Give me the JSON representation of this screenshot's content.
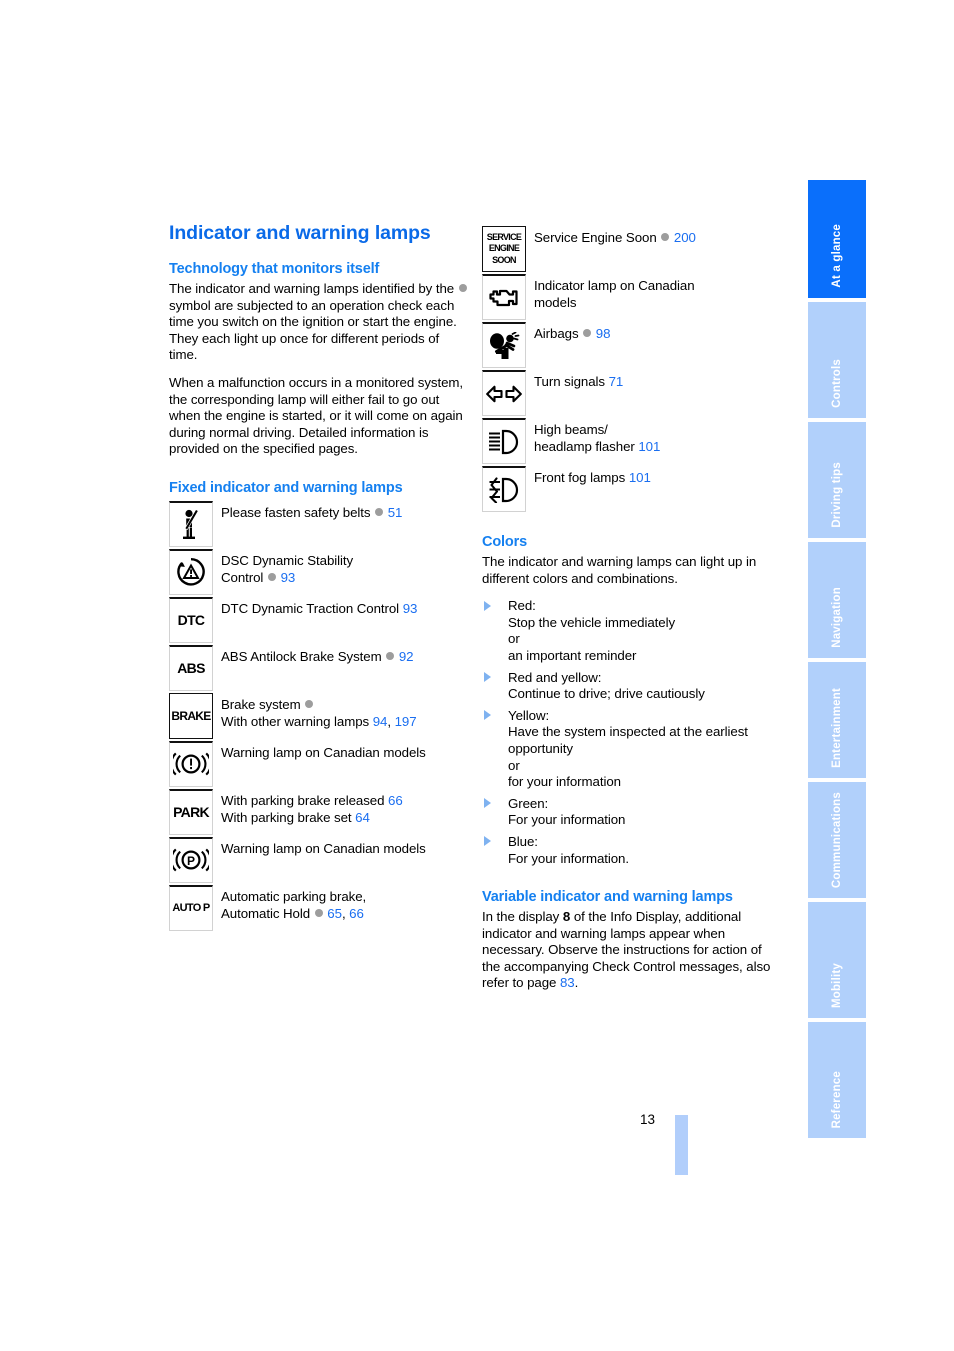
{
  "page": {
    "number": "13"
  },
  "left_column": {
    "title": "Indicator and warning lamps",
    "section1": {
      "heading": "Technology that monitors itself",
      "para1_a": "The indicator and warning lamps identified by the",
      "para1_b": "symbol are subjected to an operation check each time you switch on the ignition or start the engine. They each light up once for different periods of time.",
      "para2": "When a malfunction occurs in a monitored system, the corresponding lamp will either fail to go out when the engine is started, or it will come on again during normal driving. Detailed information is provided on the specified pages."
    },
    "section2": {
      "heading": "Fixed indicator and warning lamps",
      "lamps": [
        {
          "icon": "seatbelt-icon",
          "icon_kind": "glyph",
          "line1": "Please fasten safety belts",
          "line1_has_circle": true,
          "line1_pages": [
            "51"
          ],
          "line2": "",
          "line2_pages": []
        },
        {
          "icon": "dsc-triangle-icon",
          "icon_kind": "glyph",
          "line1": "DSC Dynamic Stability",
          "line1_has_circle": false,
          "line1_pages": [],
          "line2": "Control",
          "line2_has_circle": true,
          "line2_pages": [
            "93"
          ]
        },
        {
          "icon": "dtc-icon",
          "icon_kind": "text",
          "icon_text": "DTC",
          "line1": "DTC Dynamic Traction Control",
          "line1_has_circle": false,
          "line1_pages": [
            "93"
          ],
          "line2": "",
          "line2_pages": []
        },
        {
          "icon": "abs-icon",
          "icon_kind": "text",
          "icon_text": "ABS",
          "line1": "ABS Antilock Brake System",
          "line1_has_circle": true,
          "line1_pages": [
            "92"
          ],
          "line2": "",
          "line2_pages": []
        },
        {
          "icon": "brake-icon",
          "icon_kind": "text-boxed",
          "icon_text": "BRAKE",
          "line1": "Brake system",
          "line1_has_circle": true,
          "line1_pages": [],
          "line2": "With other warning lamps",
          "line2_has_circle": false,
          "line2_pages": [
            "94",
            "197"
          ]
        },
        {
          "icon": "brake-warning-canadian-icon",
          "icon_kind": "glyph",
          "line1": "Warning lamp on Canadian models",
          "line1_has_circle": false,
          "line1_pages": [],
          "line2": "",
          "line2_pages": []
        },
        {
          "icon": "park-icon",
          "icon_kind": "text",
          "icon_text": "PARK",
          "line1": "With parking brake released",
          "line1_has_circle": false,
          "line1_pages": [
            "66"
          ],
          "line2": "With parking brake set",
          "line2_has_circle": false,
          "line2_pages": [
            "64"
          ]
        },
        {
          "icon": "parking-brake-canadian-icon",
          "icon_kind": "glyph",
          "line1": "Warning lamp on Canadian models",
          "line1_has_circle": false,
          "line1_pages": [],
          "line2": "",
          "line2_pages": []
        },
        {
          "icon": "auto-p-icon",
          "icon_kind": "text",
          "icon_text": "AUTO P",
          "line1": "Automatic parking brake,",
          "line1_has_circle": false,
          "line1_pages": [],
          "line2": "Automatic Hold",
          "line2_has_circle": true,
          "line2_pages": [
            "65",
            "66"
          ]
        }
      ]
    }
  },
  "right_column": {
    "lamps": [
      {
        "icon": "service-engine-soon-icon",
        "icon_kind": "text-boxed-3line",
        "icon_text_lines": [
          "SERVICE",
          "ENGINE",
          "SOON"
        ],
        "line1": "Service Engine Soon",
        "line1_has_circle": true,
        "line1_pages": [
          "200"
        ],
        "line2": "",
        "line2_pages": []
      },
      {
        "icon": "engine-malfunction-icon",
        "icon_kind": "glyph",
        "line1": "Indicator lamp on Canadian",
        "line1_has_circle": false,
        "line1_pages": [],
        "line2": "models",
        "line2_has_circle": false,
        "line2_pages": []
      },
      {
        "icon": "airbag-icon",
        "icon_kind": "glyph",
        "line1": "Airbags",
        "line1_has_circle": true,
        "line1_pages": [
          "98"
        ],
        "line2": "",
        "line2_pages": []
      },
      {
        "icon": "turn-signal-icon",
        "icon_kind": "glyph",
        "line1": "Turn signals",
        "line1_has_circle": false,
        "line1_pages": [
          "71"
        ],
        "line2": "",
        "line2_pages": []
      },
      {
        "icon": "high-beam-icon",
        "icon_kind": "glyph",
        "line1": "High beams/",
        "line1_has_circle": false,
        "line1_pages": [],
        "line2": "headlamp flasher",
        "line2_has_circle": false,
        "line2_pages": [
          "101"
        ]
      },
      {
        "icon": "front-fog-lamp-icon",
        "icon_kind": "glyph",
        "line1": "Front fog lamps",
        "line1_has_circle": false,
        "line1_pages": [
          "101"
        ],
        "line2": "",
        "line2_pages": []
      }
    ],
    "colors_section": {
      "heading": "Colors",
      "intro": "The indicator and warning lamps can light up in different colors and combinations.",
      "items": [
        "Red:\nStop the vehicle immediately\nor\nan important reminder",
        "Red and yellow:\nContinue to drive; drive cautiously",
        "Yellow:\nHave the system inspected at the earliest opportunity\nor\nfor your information",
        "Green:\nFor your information",
        "Blue:\nFor your information."
      ]
    },
    "variable_section": {
      "heading": "Variable indicator and warning lamps",
      "text_a": "In the display",
      "display_ref": "8",
      "text_b": "of the Info Display, additional indicator and warning lamps appear when necessary. Observe the instructions for action of the accompanying Check Control messages, also refer to page",
      "page_ref": "83",
      "text_c": "."
    }
  },
  "sidebar": {
    "tabs": [
      {
        "label": "At a glance",
        "active": true
      },
      {
        "label": "Controls",
        "active": false
      },
      {
        "label": "Driving tips",
        "active": false
      },
      {
        "label": "Navigation",
        "active": false
      },
      {
        "label": "Entertainment",
        "active": false
      },
      {
        "label": "Communications",
        "active": false
      },
      {
        "label": "Mobility",
        "active": false
      },
      {
        "label": "Reference",
        "active": false
      }
    ]
  },
  "colors": {
    "heading_blue": "#0a6ae8",
    "link_blue": "#1a6ef0",
    "tab_active": "#0a6ffb",
    "tab_inactive": "#b1d0fb",
    "op_circle": "#9d9d9d"
  }
}
